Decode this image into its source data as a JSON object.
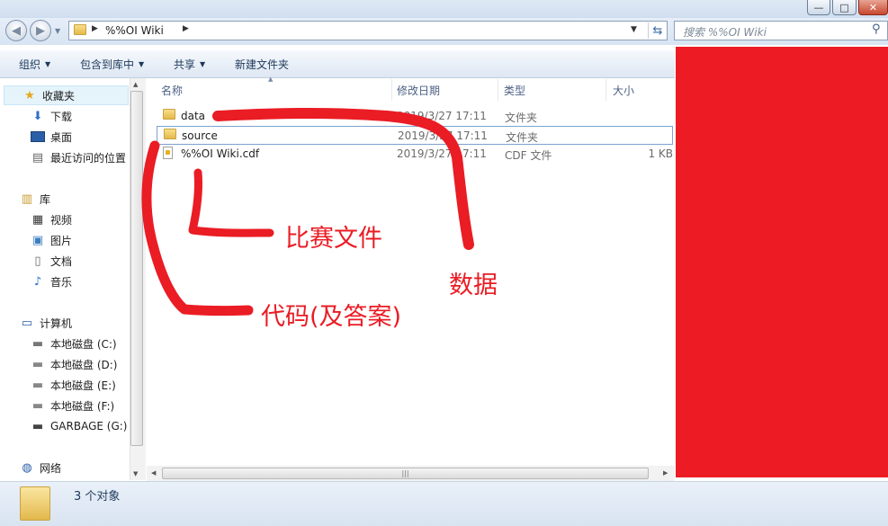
{
  "window": {
    "minimize_glyph": "—",
    "maximize_glyph": "□",
    "close_glyph": "✕"
  },
  "address": {
    "path_text": "%%OI Wiki"
  },
  "search": {
    "placeholder": "搜索 %%OI Wiki"
  },
  "toolbar": {
    "organize": "组织",
    "include_library": "包含到库中",
    "share": "共享",
    "new_folder": "新建文件夹"
  },
  "nav": {
    "favorites": "收藏夹",
    "downloads": "下载",
    "desktop": "桌面",
    "recent": "最近访问的位置",
    "libraries": "库",
    "videos": "视频",
    "pictures": "图片",
    "documents": "文档",
    "music": "音乐",
    "computer": "计算机",
    "drive_c": "本地磁盘 (C:)",
    "drive_d": "本地磁盘 (D:)",
    "drive_e": "本地磁盘 (E:)",
    "drive_f": "本地磁盘 (F:)",
    "drive_g": "GARBAGE (G:)",
    "network": "网络"
  },
  "columns": {
    "name": "名称",
    "date": "修改日期",
    "type": "类型",
    "size": "大小"
  },
  "files": [
    {
      "name": "data",
      "date": "2019/3/27 17:11",
      "type": "文件夹",
      "size": ""
    },
    {
      "name": "source",
      "date": "2019/3/27 17:11",
      "type": "文件夹",
      "size": ""
    },
    {
      "name": "%%OI Wiki.cdf",
      "date": "2019/3/27 17:11",
      "type": "CDF 文件",
      "size": "1 KB"
    }
  ],
  "status": {
    "count": "3 个对象"
  },
  "annotations": {
    "contest_files": "比赛文件",
    "data": "数据",
    "code": "代码(及答案)",
    "color": "#ea1c24"
  },
  "redaction_color": "#ed1c24"
}
